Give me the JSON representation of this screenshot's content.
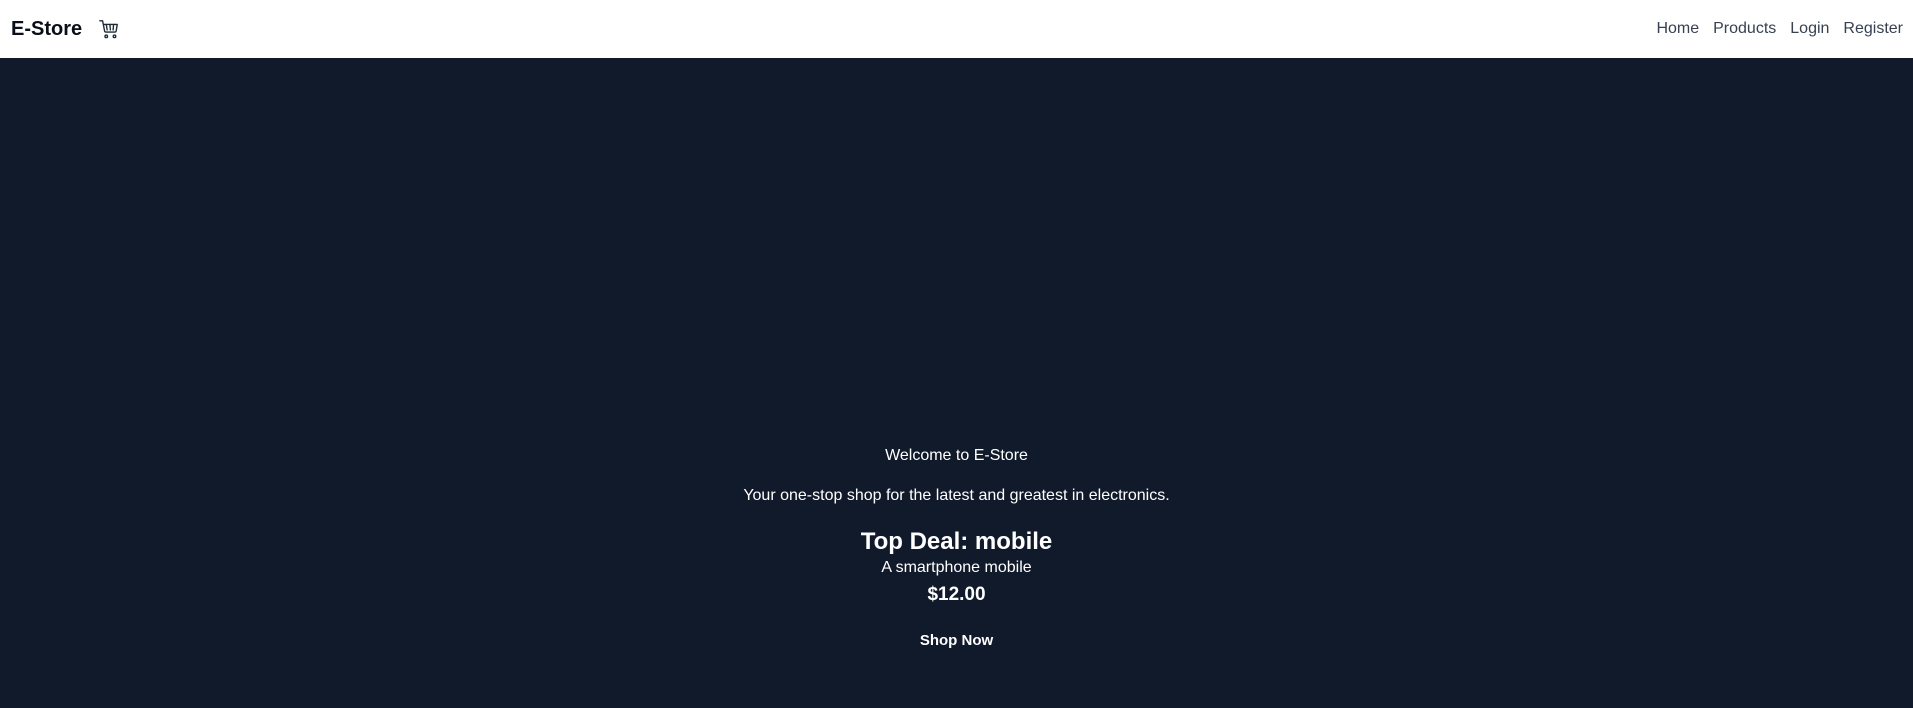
{
  "navbar": {
    "brand": "E-Store",
    "cart_icon": "shopping-cart-icon",
    "links": [
      "Home",
      "Products",
      "Login",
      "Register"
    ]
  },
  "hero": {
    "welcome": "Welcome to E-Store",
    "tagline": "Your one-stop shop for the latest and greatest in electronics.",
    "deal_title": "Top Deal: mobile",
    "deal_description": "A smartphone mobile",
    "deal_price": "$12.00",
    "cta_label": "Shop Now"
  },
  "colors": {
    "navbar_bg": "#ffffff",
    "hero_bg": "#111a2a",
    "link": "#374151",
    "text_light": "#ffffff"
  }
}
